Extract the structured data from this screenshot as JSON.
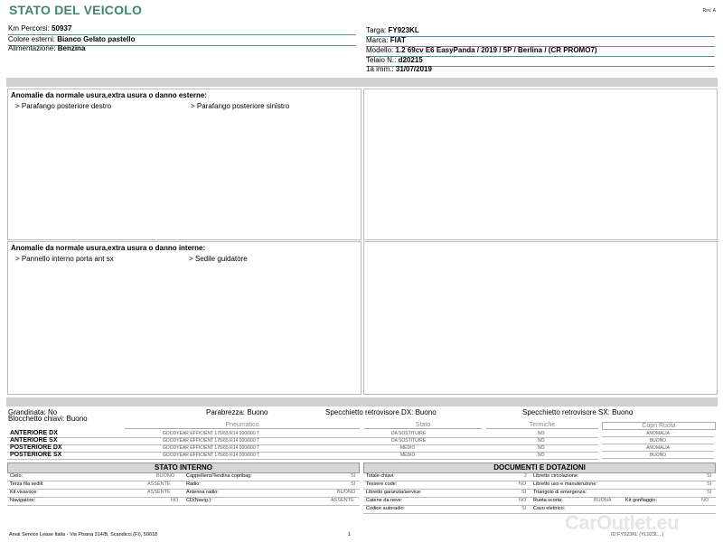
{
  "header": {
    "title": "STATO DEL VEICOLO",
    "rev": "Rev. A"
  },
  "info_left": [
    {
      "label": "Km Percorsi:",
      "value": "50937"
    },
    {
      "label": "Colore esterni:",
      "value": "Bianco Gelato pastello"
    },
    {
      "label": "Alimentazione:",
      "value": "Benzina"
    }
  ],
  "info_right": [
    {
      "label": "Targa:",
      "value": "FY923KL"
    },
    {
      "label": "Marca:",
      "value": "FIAT"
    },
    {
      "label": "Modello:",
      "value": "1.2 69cv E6 EasyPanda / 2019 / 5P / Berlina / (CR PROMO7)"
    },
    {
      "label": "Telaio N.:",
      "value": "d20215"
    },
    {
      "label": "1a imm.:",
      "value": "31/07/2019"
    }
  ],
  "external_damage": {
    "title": "Anomalie da normale usura,extra usura o danno esterne:",
    "items": [
      "> Parafango posteriore destro",
      "> Parafango posteriore sinistro"
    ]
  },
  "internal_damage": {
    "title": "Anomalie da normale usura,extra usura o danno interne:",
    "items": [
      "> Pannello interno porta ant sx",
      "> Sedile guidatore"
    ]
  },
  "conditions": {
    "grandinata": "Grandinata: No",
    "parabrezza": "Parabrezza: Buono",
    "specchietto_dx": "Specchietto retrovisore DX: Buono",
    "specchietto_sx": "Specchietto retrovisore SX: Buono",
    "blocchetto": "Blocchetto chiavi: Buono"
  },
  "tyres": {
    "headers": {
      "pneumatico": "Pneumatico",
      "stato": "Stato",
      "termiche": "Termiche",
      "copri_ruota": "Copri Ruota"
    },
    "rows": [
      {
        "pos": "ANTERIORE DX",
        "tyre": "GOODYEAR EFFICIENT  175/65 R14 000/000 T",
        "stato": "DA SOSTITUIRE",
        "termiche": "NO",
        "copri": "ANOMALIA"
      },
      {
        "pos": "ANTERIORE SX",
        "tyre": "GOODYEAR EFFICIENT  175/65 R14 000/000 T",
        "stato": "DA SOSTITUIRE",
        "termiche": "NO",
        "copri": "BUONO"
      },
      {
        "pos": "POSTERIORE DX",
        "tyre": "GOODYEAR EFFICIENT  175/65 R14 000/000 T",
        "stato": "MEDIO",
        "termiche": "NO",
        "copri": "ANOMALIA"
      },
      {
        "pos": "POSTERIORE SX",
        "tyre": "GOODYEAR EFFICIENT  175/65 R14 000/000 T",
        "stato": "MEDIO",
        "termiche": "NO",
        "copri": "BUONO"
      }
    ]
  },
  "stato_interno": {
    "title": "STATO INTERNO",
    "rows": [
      [
        {
          "l": "Cielo:",
          "v": "BUONO"
        },
        {
          "l": "Cappelliera/Tendina copribag:",
          "v": "SI"
        }
      ],
      [
        {
          "l": "Terza fila sedili:",
          "v": "ASSENTE"
        },
        {
          "l": "Radio:",
          "v": "SI"
        }
      ],
      [
        {
          "l": "Kit vivavoce:",
          "v": "ASSENTE"
        },
        {
          "l": "Antenna radio:",
          "v": "BUONO"
        }
      ],
      [
        {
          "l": "Navigatore:",
          "v": "NO"
        },
        {
          "l": "CD(Navig.):",
          "v": "ASSENTE"
        }
      ]
    ]
  },
  "documenti": {
    "title": "DOCUMENTI E DOTAZIONI",
    "rows": [
      [
        {
          "l": "Totale chiavi:",
          "v": "2"
        },
        {
          "l": "Libretto circolazione:",
          "v": "SI"
        }
      ],
      [
        {
          "l": "Tessere code:",
          "v": "NO"
        },
        {
          "l": "Libretto uso e manutenzione:",
          "v": "SI"
        }
      ],
      [
        {
          "l": "Libretto garanzia/service:",
          "v": "SI"
        },
        {
          "l": "Triangolo di emergenza:",
          "v": "SI"
        }
      ],
      [
        {
          "l": "Catene da neve:",
          "v": "NO"
        },
        {
          "l": "Ruota scorta:",
          "v": "BUONA"
        },
        {
          "l": "Kit gonfiaggio:",
          "v": "NO"
        }
      ],
      [
        {
          "l": "Codice autoradio:",
          "v": "SI"
        },
        {
          "l": "Cavo elettrico:",
          "v": ""
        }
      ]
    ]
  },
  "footer": {
    "address": "Arval Service Lease Italia - Via Pisana 314/B, Scandicci (FI), 50018",
    "page": "1",
    "code": "ID:FY923KL (YL923L...)"
  },
  "watermark": "CarOutlet.eu"
}
